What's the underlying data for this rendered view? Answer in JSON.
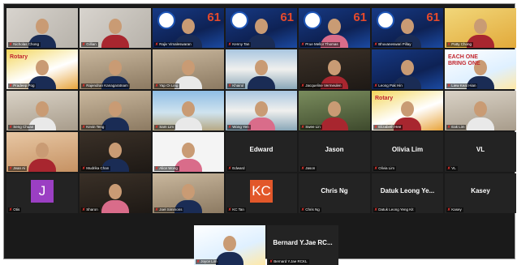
{
  "meeting": {
    "tiles": [
      {
        "name": "Nicholas Chong",
        "bg": "bg-stage",
        "figure": "navy",
        "speaker": false
      },
      {
        "name": "Gillian",
        "bg": "bg-stage",
        "figure": "red",
        "speaker": true
      },
      {
        "name": "Rajiv Vimaleswaran",
        "bg": "bg-blue",
        "figure": "navy",
        "logo": true
      },
      {
        "name": "Kenny Tan",
        "bg": "bg-blue",
        "figure": "navy",
        "logo": true
      },
      {
        "name": "Prue Mellor Thomas",
        "bg": "bg-blue",
        "figure": "pink",
        "logo": true
      },
      {
        "name": "Bhuvaneswari Pillay",
        "bg": "bg-blue",
        "figure": "navy",
        "logo": true
      },
      {
        "name": "Patty Chong",
        "bg": "bg-yellow",
        "figure": "red"
      },
      {
        "name": "Pradeep Pog",
        "bg": "bg-poster",
        "figure": "navy",
        "poster": "Rotary"
      },
      {
        "name": "Rajendran Kanagaratnam",
        "bg": "bg-room",
        "figure": "navy"
      },
      {
        "name": "Yap Oi Ling",
        "bg": "bg-room",
        "figure": "white"
      },
      {
        "name": "Khairul",
        "bg": "bg-city",
        "figure": "navy"
      },
      {
        "name": "Jacqueline Vermeulen",
        "bg": "bg-dark",
        "figure": "red"
      },
      {
        "name": "Leong Pak Hin",
        "bg": "bg-blue",
        "figure": "navy"
      },
      {
        "name": "Liew Keat Hian",
        "bg": "bg-logo",
        "figure": "navy",
        "poster": "EACH ONE BRING ONE"
      },
      {
        "name": "Seng Chuan",
        "bg": "bg-office",
        "figure": "white"
      },
      {
        "name": "Kevin Teng",
        "bg": "bg-room",
        "figure": "navy"
      },
      {
        "name": "Sam Lim",
        "bg": "bg-sea",
        "figure": "white"
      },
      {
        "name": "Wong Yen",
        "bg": "bg-city",
        "figure": "pink"
      },
      {
        "name": "Swee Lin",
        "bg": "bg-green",
        "figure": "red"
      },
      {
        "name": "Elizabeth Hee",
        "bg": "bg-poster",
        "figure": "red",
        "poster": "Rotary"
      },
      {
        "name": "Eak Lim",
        "bg": "bg-office",
        "figure": "white"
      },
      {
        "name": "Jean Ai",
        "bg": "bg-peach",
        "figure": "red"
      },
      {
        "name": "Mudrika Chan",
        "bg": "bg-dark",
        "figure": "navy"
      },
      {
        "name": "Alice Wong",
        "bg": "bg-white",
        "figure": "pink"
      },
      {
        "name": "Edward",
        "center": "Edward"
      },
      {
        "name": "Jason",
        "center": "Jason"
      },
      {
        "name": "Olivia Lim",
        "center": "Olivia Lim"
      },
      {
        "name": "VL",
        "center": "VL"
      },
      {
        "name": "Otis",
        "avatar": "J",
        "avatar_color": "purple"
      },
      {
        "name": "Sharon",
        "bg": "bg-dark",
        "figure": "pink"
      },
      {
        "name": "Joel Simmons",
        "bg": "bg-room",
        "figure": "navy"
      },
      {
        "name": "KC Tan",
        "avatar": "KC",
        "avatar_color": "orange"
      },
      {
        "name": "Chris Ng",
        "center": "Chris Ng"
      },
      {
        "name": "Datuk Leong Yeng Kit",
        "center": "Datuk Leong Ye..."
      },
      {
        "name": "Kasey",
        "center": "Kasey"
      }
    ],
    "last_row": [
      {
        "name": "Joyce Lim",
        "bg": "bg-logo",
        "figure": "navy"
      },
      {
        "name": "Bernard Y.Jae RCKL",
        "center": "Bernard Y.Jae RC..."
      }
    ],
    "logo_badge": "61"
  }
}
